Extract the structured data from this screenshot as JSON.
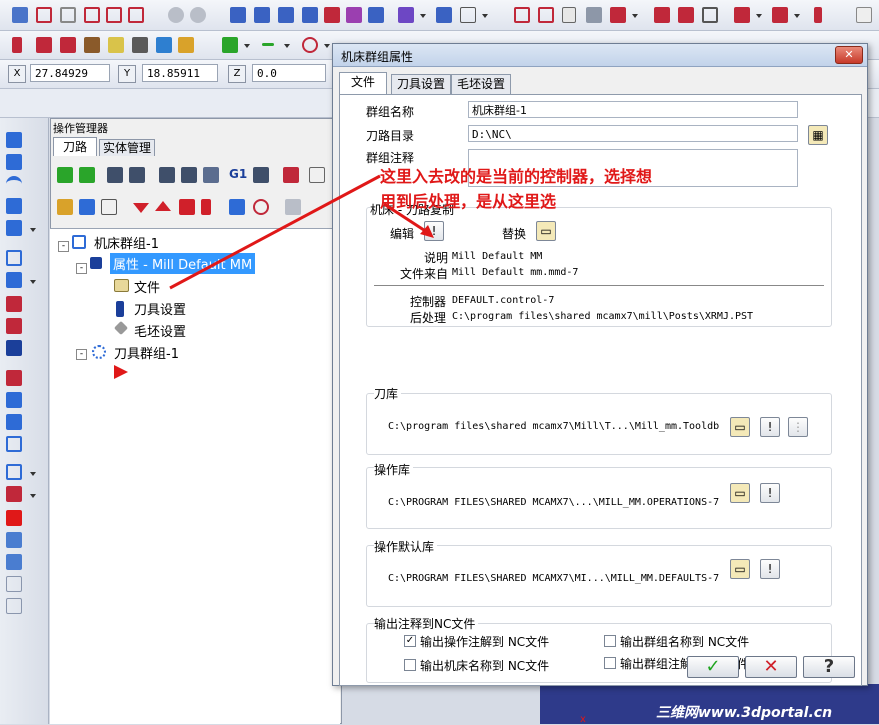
{
  "coords": {
    "x_label": "X",
    "x_value": "27.84929",
    "y_label": "Y",
    "y_value": "18.85911",
    "z_label": "Z",
    "z_value": "0.0"
  },
  "op_manager": {
    "title": "操作管理器",
    "tabs": [
      "刀路",
      "实体管理"
    ],
    "tree": {
      "machine_group": "机床群组-1",
      "properties": "属性 - Mill Default MM",
      "files": "文件",
      "tool_settings": "刀具设置",
      "stock_settings": "毛坯设置",
      "toolpath_group": "刀具群组-1"
    }
  },
  "dialog": {
    "title": "机床群组属性",
    "tabs": [
      "文件",
      "刀具设置",
      "毛坯设置"
    ],
    "group_name_label": "群组名称",
    "group_name_value": "机床群组-1",
    "toolpath_dir_label": "刀路目录",
    "toolpath_dir_value": "D:\\NC\\",
    "group_comment_label": "群组注释",
    "machine_copy": {
      "title": "机床 - 刀路复制",
      "edit_label": "编辑",
      "replace_label": "替换",
      "desc_label": "说明",
      "desc_value": "Mill Default MM",
      "file_from_label": "文件来自",
      "file_from_value": "Mill Default mm.mmd-7",
      "controller_label": "控制器",
      "controller_value": "DEFAULT.control-7",
      "post_label": "后处理",
      "post_value": "C:\\program files\\shared mcamx7\\mill\\Posts\\XRMJ.PST"
    },
    "tool_lib": {
      "title": "刀库",
      "path": "C:\\program files\\shared mcamx7\\Mill\\T...\\Mill_mm.Tooldb"
    },
    "op_lib": {
      "title": "操作库",
      "path": "C:\\PROGRAM FILES\\SHARED MCAMX7\\...\\MILL_MM.OPERATIONS-7"
    },
    "op_default_lib": {
      "title": "操作默认库",
      "path": "C:\\PROGRAM FILES\\SHARED MCAMX7\\MI...\\MILL_MM.DEFAULTS-7"
    },
    "output": {
      "title": "输出注释到NC文件",
      "op_comment": "输出操作注解到 NC文件",
      "group_name": "输出群组名称到 NC文件",
      "machine_name": "输出机床名称到 NC文件",
      "group_comment": "输出群组注解到 NC文件",
      "op_comment_checked": true
    }
  },
  "annotation": {
    "line1": "这里入去改的是当前的控制器，选择想",
    "line2": "用到后处理，是从这里选"
  },
  "watermark": "三维网www.3dportal.cn",
  "colors": {
    "annotation": "#e01818",
    "selection": "#3399ff"
  }
}
